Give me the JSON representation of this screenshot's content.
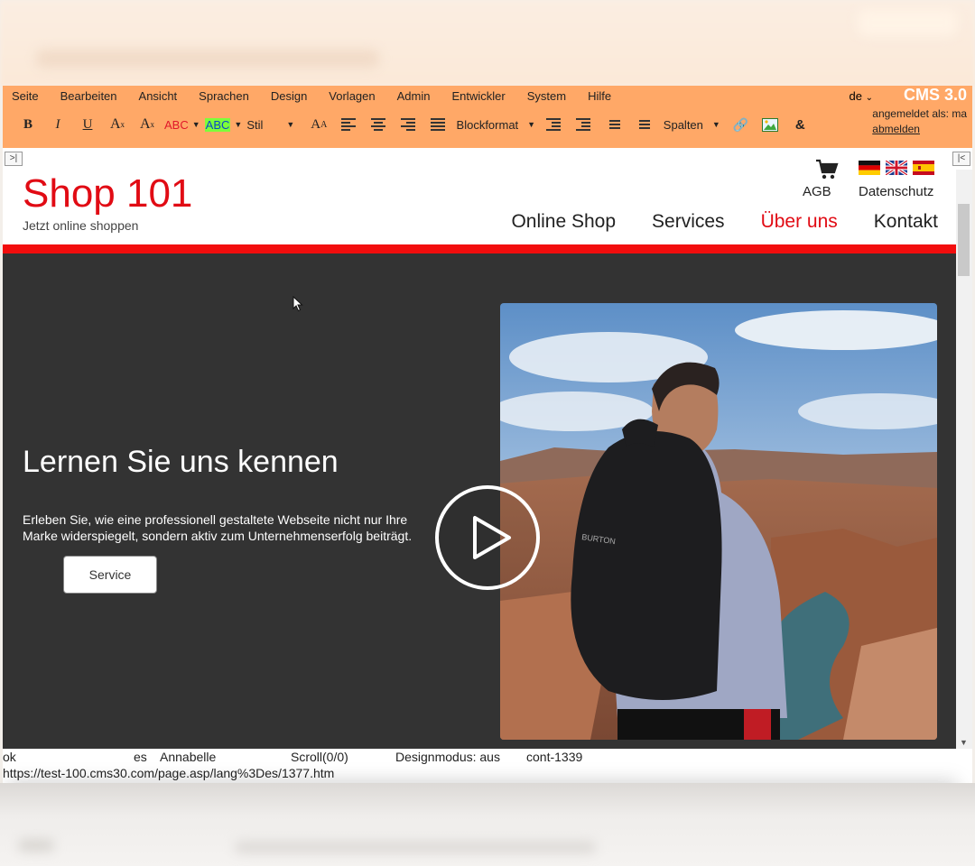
{
  "cms": {
    "menu": [
      "Seite",
      "Bearbeiten",
      "Ansicht",
      "Sprachen",
      "Design",
      "Vorlagen",
      "Admin",
      "Entwickler",
      "System",
      "Hilfe"
    ],
    "toolbar": {
      "bold": "B",
      "italic": "I",
      "underline": "U",
      "subscript": "A",
      "subscript_mark": "x",
      "superscript": "A",
      "superscript_mark": "x",
      "text_color": "ABC",
      "highlight": "ABC",
      "style": "Stil",
      "font_size": "A",
      "blockformat": "Blockformat",
      "columns": "Spalten"
    },
    "language": "de",
    "brand": "CMS 3.0",
    "login_label": "angemeldet als: ma",
    "logout": "abmelden"
  },
  "site": {
    "logo": "Shop 101",
    "tagline": "Jetzt online shoppen",
    "agb": "AGB",
    "privacy": "Datenschutz",
    "nav": [
      "Online Shop",
      "Services",
      "Über uns",
      "Kontakt"
    ],
    "active_nav": "Über uns"
  },
  "hero": {
    "title": "Lernen Sie uns kennen",
    "text": "Erleben Sie, wie eine professionell gestaltete Webseite nicht nur Ihre Marke widerspiegelt, sondern aktiv zum Unternehmenserfolg beiträgt.",
    "button": "Service",
    "backpack_brand": "BURTON"
  },
  "status": {
    "state": "ok",
    "lang": "es",
    "user": "Annabelle",
    "scroll": "Scroll(0/0)",
    "design_mode": "Designmodus: aus",
    "container": "cont-1339",
    "url": "https://test-100.cms30.com/page.asp/lang%3Des/1377.htm"
  },
  "colors": {
    "cms_bar": "#ffa867",
    "brand_red": "#e10b14",
    "hero_bg": "#333333"
  }
}
